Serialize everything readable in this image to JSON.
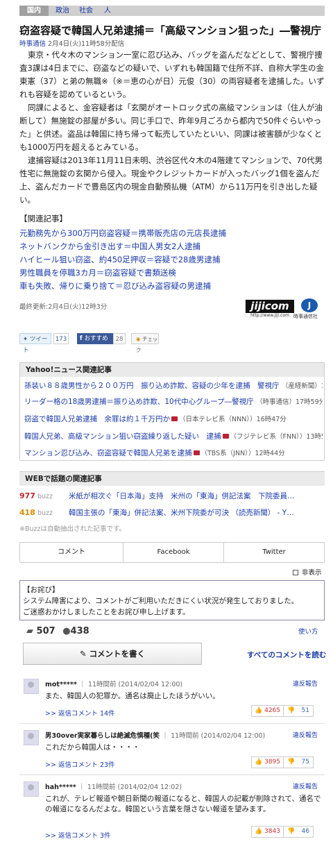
{
  "category_tabs": {
    "active": "国内",
    "items": [
      "政治",
      "社会",
      "人"
    ]
  },
  "headline": "窃盗容疑で韓国人兄弟逮捕＝「高級マンション狙った」―警視庁",
  "byline": {
    "source": "時事通信",
    "date": "2月4日(火)11時58分配信"
  },
  "body": [
    "東京・代々木のマンション一室に忍び込み、バッグを盗んだなどとして、警視庁捜査3課は4日までに、窃盗などの疑いで、いずれも韓国籍で住所不詳、自称大学生の金東憲（37）と弟の無職※（※＝恵の心が日）元俊（30）の両容疑者を逮捕した。いずれも容疑を認めているという。",
    "同課によると、金容疑者は「玄関がオートロック式の高級マンションは（住人が油断して）無施錠の部屋が多い。同じ手口で、昨年9月ごろから都内で50件ぐらいやった」と供述。盗品は韓国に持ち帰って転売していたといい、同課は被害額が少なくとも1000万円を超えるとみている。",
    "逮捕容疑は2013年11月11日未明、渋谷区代々木の4階建てマンションで、70代男性宅に無施錠の玄関から侵入。現金やクレジットカードが入ったバッグ1個を盗んだ上、盗んだカードで豊島区内の現金自動預払機（ATM）から11万円を引き出した疑い。"
  ],
  "related": {
    "title": "【関連記事】",
    "links": [
      "元勤務先から300万円窃盗容疑＝携帯販売店の元店長逮捕",
      "ネットバンクから金引き出す＝中国人男女2人逮捕",
      "ハイヒール狙い窃盗、約450足押収＝容疑で28歳男逮捕",
      "男性職員を停職3カ月＝窃盗容疑で書類送検",
      "車も失敗、帰りに乗り捨て＝忍び込み盗容疑の男逮捕"
    ]
  },
  "updated": "最終更新:2月4日(火)12時3分",
  "logo": {
    "mark": "jijicom",
    "url": "http://www.jiji.com",
    "company": "時事通信社"
  },
  "social": {
    "tweet": "ツイート",
    "tweet_count": "173",
    "recommend": "おすすめ",
    "recommend_count": "28",
    "check": "チェック"
  },
  "yahoo_related": {
    "title": "Yahoo!ニュース関連記事",
    "items": [
      {
        "text": "孫装い８８歳男性から２００万円　振り込め詐欺、容疑の少年を逮捕　警視庁",
        "meta": "（産経新聞）18時7分",
        "tv": false
      },
      {
        "text": "リーダー格の18歳男逮捕＝振り込め詐欺、10代中心グループ―警視庁",
        "meta": "（時事通信）17時59分",
        "tv": false
      },
      {
        "text": "窃盗で韓国人兄弟逮捕　余罪は約１千万円か",
        "meta": "（日本テレビ系（NNN））16時47分",
        "tv": true
      },
      {
        "text": "韓国人兄弟、高級マンション狙い窃盗繰り返した疑い　逮捕",
        "meta": "（フジテレビ系（FNN））13時5分",
        "tv": true
      },
      {
        "text": "マンション忍び込み、窃盗容疑で韓国人兄弟を逮捕",
        "meta": "（TBS系（JNN））12時44分",
        "tv": true
      }
    ]
  },
  "web_related": {
    "title": "WEBで話題の関連記事",
    "items": [
      {
        "count": "977",
        "buzz": "buzz",
        "text": "米紙が相次ぐ「日本海」支持　米州の「東海」併記法案　下院委員…",
        "color": "#c0282d"
      },
      {
        "count": "418",
        "buzz": "buzz",
        "text": "韓国主張の「東海」併記法案、米州下院委が可決 （読売新聞） - Y…",
        "color": "#e08a00"
      }
    ]
  },
  "buzz_note": "※Buzzは自動抽出された記事です。",
  "comment_tabs": [
    "コメント",
    "Facebook",
    "Twitter"
  ],
  "hide_label": "非表示",
  "apology": {
    "title": "【お詫び】",
    "lines": [
      "システム障害により、コメントがご利用いただきにくい状況が発生しておりました。",
      "ご迷惑おかけしましたことをお詫び申し上げます。"
    ]
  },
  "stats": {
    "comments": "507",
    "users": "438"
  },
  "howto": "使い方",
  "write_button": "コメントを書く",
  "all_comments": "すべてのコメントを読む",
  "comments": [
    {
      "user": "mot*****",
      "time": "11時間前 (2014/02/04 12:00)",
      "report": "違反報告",
      "text": "また、韓国人の犯罪か。通名は廃止したほうがいい。",
      "replies": ">> 返信コメント 14件",
      "good": "4265",
      "bad": "51"
    },
    {
      "user": "男30over実家暮らしは絶滅危惧種(笑",
      "time": "11時間前 (2014/02/04 12:00)",
      "report": "違反報告",
      "text": "これだから韓国人は・・・・",
      "replies": ">> 返信コメント 23件",
      "good": "3895",
      "bad": "75"
    },
    {
      "user": "hah*****",
      "time": "11時間前 (2014/02/04 12:02)",
      "report": "違反報告",
      "text": "これが、テレビ報道や朝日新聞の報道になると、韓国人の記載が削除されて、通名での報道になるんだよな。韓国という言葉を隠さない報道を望みます。",
      "replies": ">> 返信コメント 3件",
      "good": "3843",
      "bad": "46"
    }
  ]
}
